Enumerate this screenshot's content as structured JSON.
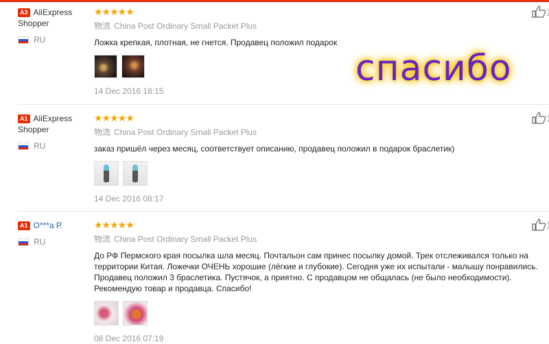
{
  "overlay_text": "спасибо",
  "reviews": [
    {
      "badge": "A3",
      "name": "AliExpress Shopper",
      "country": "RU",
      "stars": "★★★★★",
      "rating": 5,
      "ship_cn": "物流",
      "shipping": "China Post Ordinary Small Packet Plus",
      "text": "Ложка крепкая, плотная, не гнется. Продавец положил подарок",
      "date": "14 Dec 2016 18:15"
    },
    {
      "badge": "A1",
      "name": "AliExpress Shopper",
      "country": "RU",
      "stars": "★★★★★",
      "rating": 5,
      "ship_cn": "物流",
      "shipping": "China Post Ordinary Small Packet Plus",
      "text": "заказ пришёл через месяц, соответствует описанию, продавец положил в подарок браслетик)",
      "date": "14 Dec 2016 08:17"
    },
    {
      "badge": "A1",
      "name": "O***a P.",
      "country": "RU",
      "stars": "★★★★★",
      "rating": 5,
      "ship_cn": "物流",
      "shipping": "China Post Ordinary Small Packet Plus",
      "text": "До РФ Пермского края посылка шла месяц. Почтальон сам принес посылку домой. Трек отслеживался только на территории Китая. Ложечки ОЧЕНЬ хорошие (лёгкие и глубокие). Сегодня уже их испытали - малышу понравились. Продавец положил 3 браслетика. Пустячок, а приятно. С продавцом не общалась (не было необходимости). Рекомендую товар и продавца. Спасибо!",
      "date": "08 Dec 2016 07:19"
    }
  ],
  "colors": {
    "accent": "#e62e04",
    "star": "#f7a300",
    "link": "#2164a8",
    "overlay": "#6a22c8",
    "glow": "#f2d200"
  },
  "icons": {
    "like": "thumbs-up-icon",
    "flag": "russia-flag-icon"
  }
}
